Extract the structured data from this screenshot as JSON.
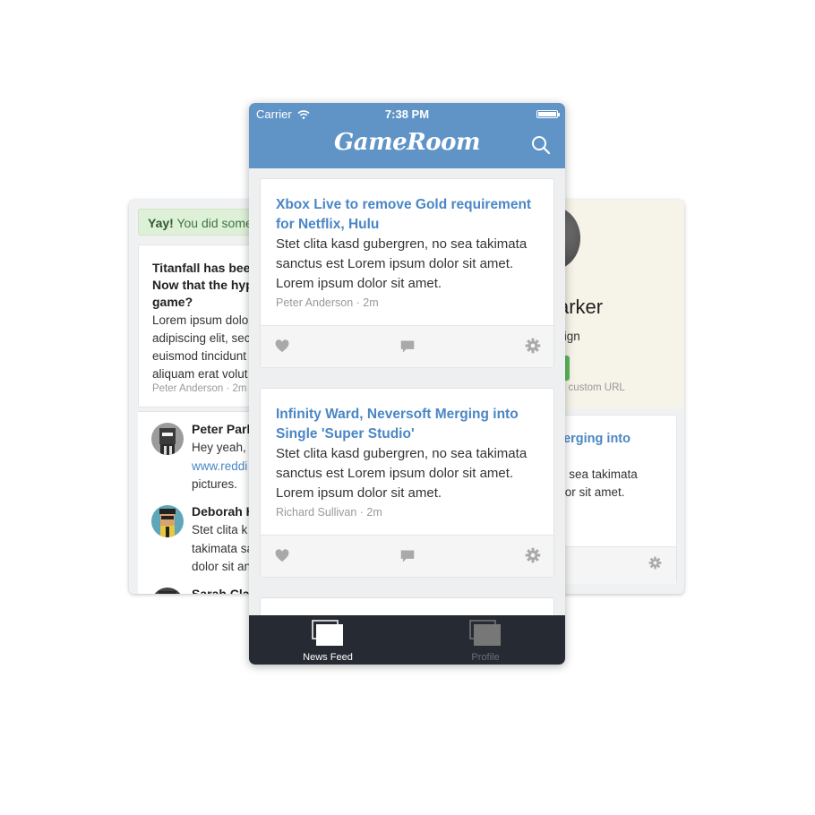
{
  "left_screen": {
    "alert": {
      "strong": "Yay!",
      "text": " You did some"
    },
    "post": {
      "title": "Titanfall has been\nNow that the hyp\ngame?",
      "body": "Lorem ipsum dolo\nadipiscing elit, sec\neuismod tincidunt\naliquam erat volut",
      "meta": "Peter Anderson · 2m"
    },
    "comments": [
      {
        "name": "Peter Park",
        "text_pre": "Hey yeah, ",
        "link": "www.reddi",
        "text_post": "pictures."
      },
      {
        "name": "Deborah H",
        "text": "Stet clita k\ntakimata sa\ndolor sit an"
      },
      {
        "name": "Sarah Cla"
      }
    ]
  },
  "right_screen": {
    "name": "arker",
    "subtitle": "sign",
    "url_hint": "y a custom URL",
    "card": {
      "title": "Merging into",
      "body": ", no sea takimata\n dolor sit amet.\net."
    }
  },
  "front_phone": {
    "status": {
      "carrier": "Carrier",
      "time": "7:38 PM"
    },
    "brand": "GameRoom",
    "posts": [
      {
        "title": "Xbox Live to remove Gold requirement\nfor Netflix, Hulu",
        "body": "Stet clita kasd gubergren, no sea takimata\nsanctus est Lorem ipsum dolor sit amet.\nLorem ipsum dolor sit amet.",
        "meta": "Peter Anderson · 2m"
      },
      {
        "title": "Infinity Ward, Neversoft Merging into\nSingle 'Super Studio'",
        "body": "Stet clita kasd gubergren, no sea takimata\nsanctus est Lorem ipsum dolor sit amet.\nLorem ipsum dolor sit amet.",
        "meta": "Richard Sullivan · 2m"
      }
    ],
    "tabs": [
      {
        "label": "News Feed",
        "active": true
      },
      {
        "label": "Profile",
        "active": false
      }
    ]
  },
  "colors": {
    "navbar": "#6094c7",
    "link": "#4a86c5",
    "tabbar": "#262b33",
    "alert_bg": "#dff0d8",
    "profile_button": "#5cb85c"
  },
  "icons": [
    "wifi-icon",
    "battery-icon",
    "search-icon",
    "heart-icon",
    "comment-icon",
    "gear-icon",
    "news-feed-icon",
    "profile-icon"
  ]
}
